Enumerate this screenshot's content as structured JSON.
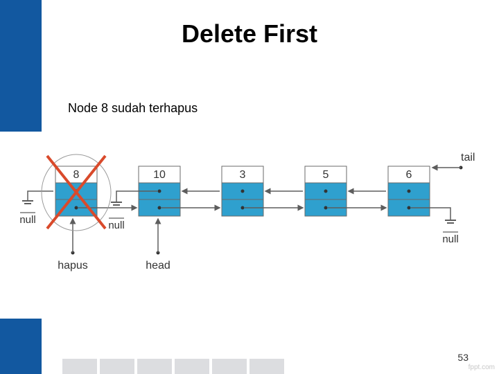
{
  "title": "Delete First",
  "caption": "Node 8 sudah terhapus",
  "nodes": {
    "values": [
      "8",
      "10",
      "3",
      "5",
      "6"
    ]
  },
  "labels": {
    "null_left": "null",
    "null_mid": "null",
    "null_right": "null",
    "hapus": "hapus",
    "head": "head",
    "tail": "tail"
  },
  "page_number": "53",
  "watermark": "fppt.com"
}
